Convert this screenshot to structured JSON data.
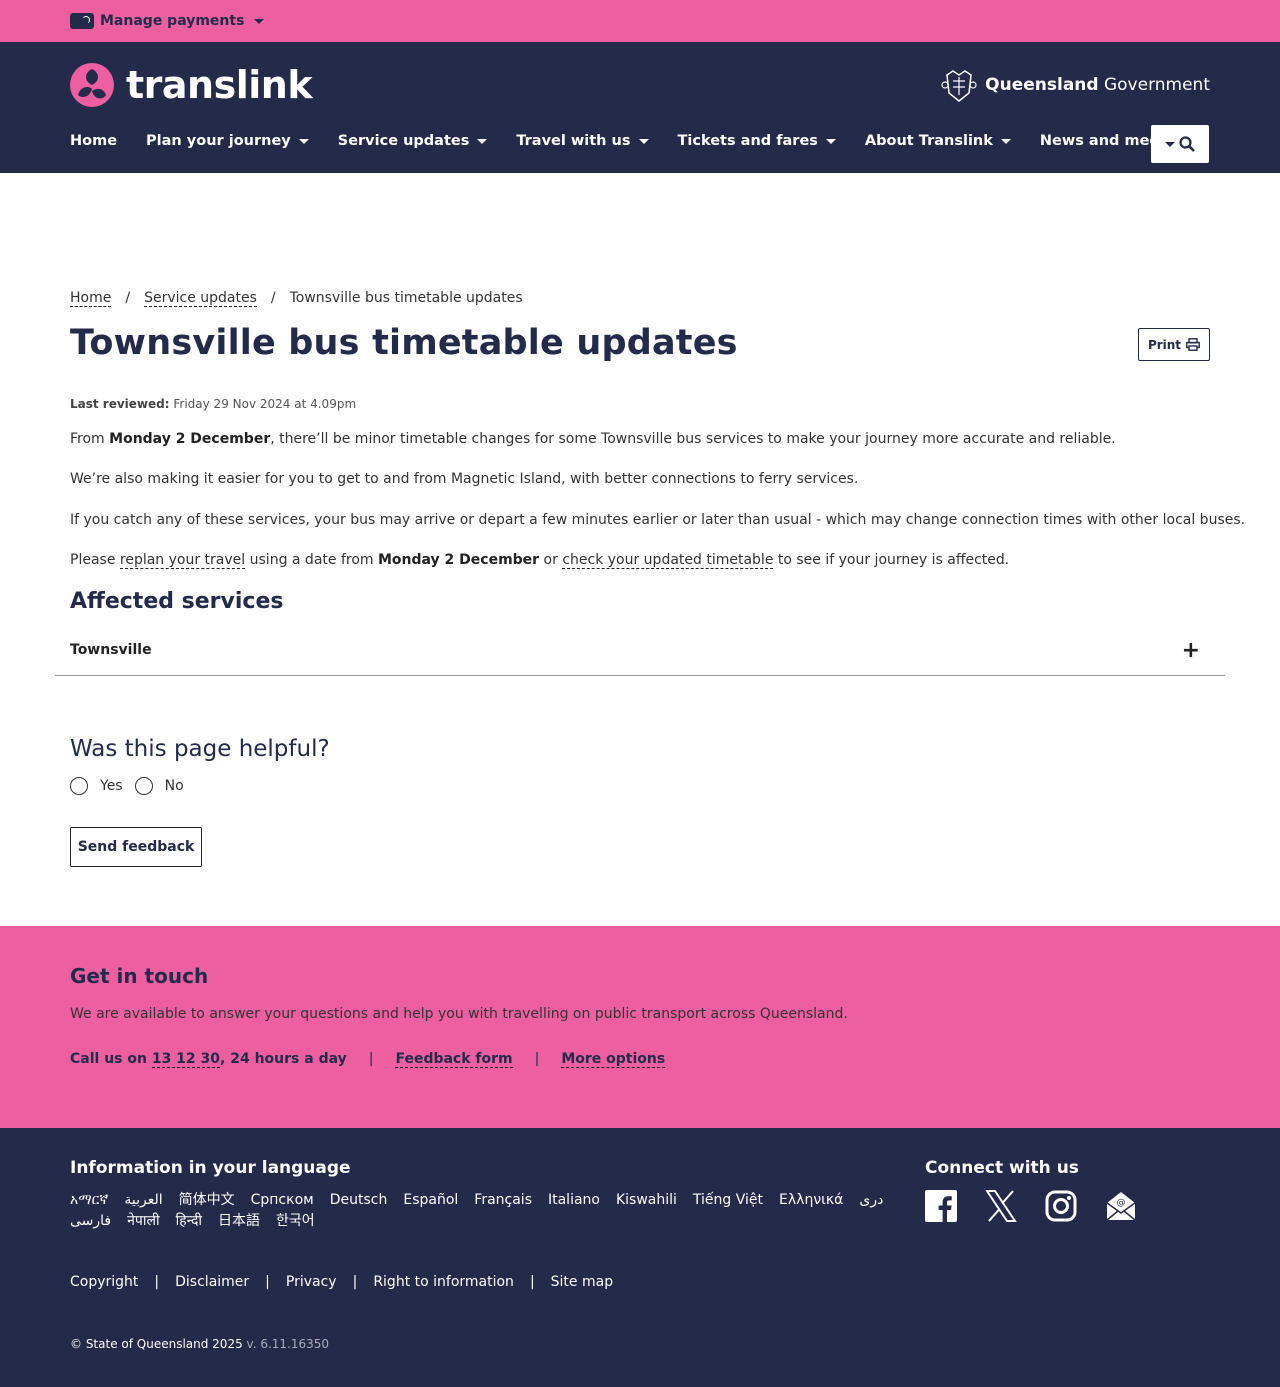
{
  "topbar": {
    "manage_label": "Manage payments"
  },
  "header": {
    "logo_text": "translink",
    "gov_bold": "Queensland",
    "gov_rest": " Government",
    "nav": [
      {
        "label": "Home",
        "has_caret": false
      },
      {
        "label": "Plan your journey",
        "has_caret": true
      },
      {
        "label": "Service updates",
        "has_caret": true
      },
      {
        "label": "Travel with us",
        "has_caret": true
      },
      {
        "label": "Tickets and fares",
        "has_caret": true
      },
      {
        "label": "About Translink",
        "has_caret": true
      },
      {
        "label": "News and media",
        "has_caret": true
      }
    ]
  },
  "breadcrumb": {
    "home": "Home",
    "section": "Service updates",
    "current": "Townsville bus timetable updates",
    "sep": "/"
  },
  "page": {
    "title": "Townsville bus timetable updates",
    "print_label": "Print",
    "reviewed_label": "Last reviewed:",
    "reviewed_value": "Friday 29 Nov 2024 at 4.09pm",
    "p1_a": "From ",
    "p1_b": "Monday 2 December",
    "p1_c": ", there’ll be minor timetable changes for some Townsville bus services to make your journey more accurate and reliable.",
    "p2": "We’re also making it easier for you to get to and from Magnetic Island, with better connections to ferry services.",
    "p3": "If you catch any of these services, your bus may arrive or depart a few minutes earlier or later than usual - which may change connection times with other local buses.",
    "p4_a": "Please ",
    "p4_link1": "replan your travel",
    "p4_b": " using a date from ",
    "p4_bold": "Monday 2 December",
    "p4_c": " or ",
    "p4_link2": "check your updated timetable",
    "p4_d": " to see if your journey is affected.",
    "affected_heading": "Affected services",
    "accordion_label": "Townsville",
    "helpful_heading": "Was this page helpful?",
    "yes_label": "Yes",
    "no_label": "No",
    "send_feedback": "Send feedback"
  },
  "touch": {
    "heading": "Get in touch",
    "body": "We are available to answer your questions and help you with travelling on public transport across Queensland.",
    "call_a": "Call us on ",
    "call_number": "13 12 30",
    "call_b": ", 24 hours a day",
    "sep": "|",
    "feedback_form": "Feedback form",
    "more_options": "More options"
  },
  "footer": {
    "lang_heading": "Information in your language",
    "languages": [
      "አማርኛ",
      "العربية",
      "简体中文",
      "Српском",
      "Deutsch",
      "Español",
      "Français",
      "Italiano",
      "Kiswahili",
      "Tiếng Việt",
      "Ελληνικά",
      "دری",
      "فارسی",
      "नेपाली",
      "हिन्दी",
      "日本語",
      "한국어"
    ],
    "connect_heading": "Connect with us",
    "social_icons": [
      "facebook-icon",
      "x-icon",
      "instagram-icon",
      "email-icon"
    ],
    "legal": [
      "Copyright",
      "Disclaimer",
      "Privacy",
      "Right to information",
      "Site map"
    ],
    "legal_sep": "|",
    "copyright": "© State of Queensland 2025",
    "version": "v. 6.11.16350"
  },
  "colors": {
    "pink": "#ee5fa1",
    "navy": "#232a4a"
  }
}
